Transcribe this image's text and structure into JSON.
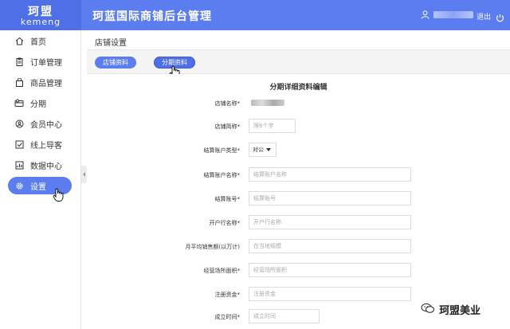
{
  "header": {
    "logo_cn": "珂盟",
    "logo_en": "kemeng",
    "app_title": "珂蓝国际商铺后台管理",
    "logout_label": "退出"
  },
  "sidebar": {
    "items": [
      {
        "label": "首页",
        "icon": "home-icon"
      },
      {
        "label": "订单管理",
        "icon": "clipboard-icon"
      },
      {
        "label": "商品管理",
        "icon": "bag-icon"
      },
      {
        "label": "分期",
        "icon": "card-icon"
      },
      {
        "label": "会员中心",
        "icon": "member-icon"
      },
      {
        "label": "线上导客",
        "icon": "checkbox-icon"
      },
      {
        "label": "数据中心",
        "icon": "chart-icon"
      },
      {
        "label": "设置",
        "icon": "gear-icon",
        "active": true
      }
    ]
  },
  "content": {
    "breadcrumb": "店铺设置",
    "tabs": [
      {
        "label": "店铺资料"
      },
      {
        "label": "分期资料",
        "selected": true
      }
    ],
    "form_title": "分期详细资料编辑",
    "fields": [
      {
        "label": "店铺名称*",
        "value": "",
        "placeholder": ""
      },
      {
        "label": "店铺简称*",
        "placeholder": "限6个字"
      },
      {
        "label": "结算账户类型*",
        "value": "对公"
      },
      {
        "label": "结算账户名称*",
        "placeholder": "结算账户名称"
      },
      {
        "label": "结算账号*",
        "placeholder": "结算账号"
      },
      {
        "label": "开户行名称*",
        "placeholder": "开户行名称"
      },
      {
        "label": "月平均销售额(以万计)",
        "placeholder": "在当地规模"
      },
      {
        "label": "经营场所面积*",
        "placeholder": "经营场所面积"
      },
      {
        "label": "注册资金*",
        "placeholder": "注册资金"
      },
      {
        "label": "成立时间*",
        "placeholder": "成立时间"
      }
    ]
  },
  "watermark": {
    "text": "珂盟美业"
  },
  "colors": {
    "primary": "#5b7df0",
    "logo_bg": "#4f6fe6"
  }
}
